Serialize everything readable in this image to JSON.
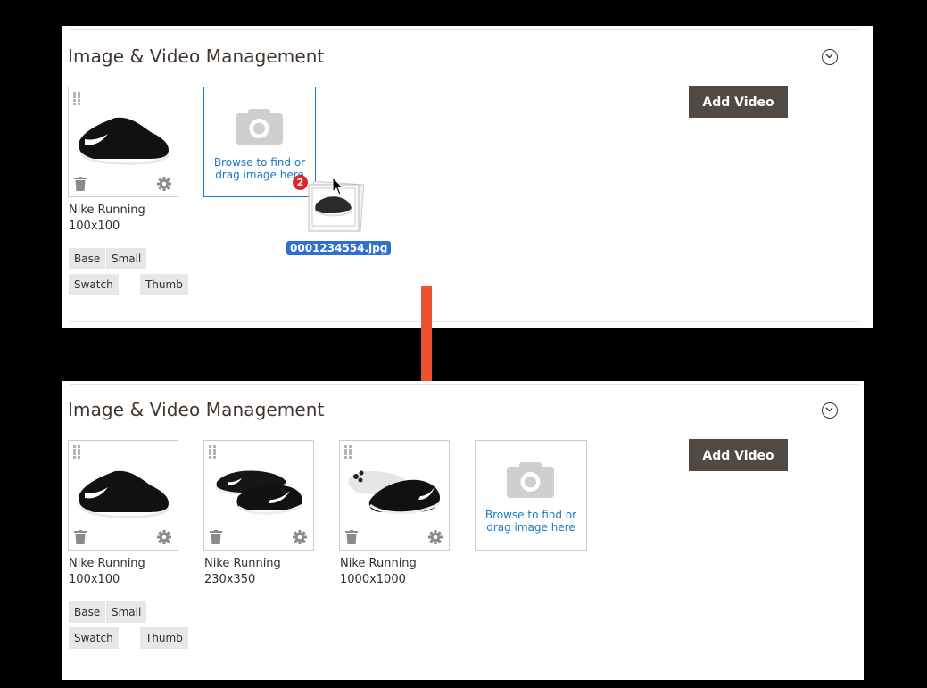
{
  "before": {
    "title": "Image & Video Management",
    "add_video_label": "Add Video",
    "images": [
      {
        "name": "Nike Running",
        "size": "100x100",
        "roles": [
          "Base",
          "Small",
          "Swatch",
          "Thumb"
        ]
      }
    ],
    "dropzone_text_line1": "Browse to find or",
    "dropzone_text_line2": "drag image here",
    "drag": {
      "count": "2",
      "filename": "0001234554.jpg"
    }
  },
  "after": {
    "title": "Image & Video Management",
    "add_video_label": "Add Video",
    "images": [
      {
        "name": "Nike Running",
        "size": "100x100",
        "roles": [
          "Base",
          "Small",
          "Swatch",
          "Thumb"
        ]
      },
      {
        "name": "Nike Running",
        "size": "230x350"
      },
      {
        "name": "Nike Running",
        "size": "1000x1000"
      }
    ],
    "dropzone_text_line1": "Browse to find or",
    "dropzone_text_line2": "drag image here"
  },
  "colors": {
    "button_bg": "#514943",
    "link": "#1979c3",
    "arrow": "#eb5230",
    "badge": "#e22626",
    "filename_highlight": "#2f6fd0"
  },
  "icons": {
    "collapse": "chevron-circle-down-icon",
    "drag": "drag-handle-icon",
    "trash": "trash-icon",
    "gear": "gear-icon",
    "camera": "camera-icon",
    "arrow": "arrow-down-icon",
    "cursor": "mouse-pointer-icon"
  }
}
